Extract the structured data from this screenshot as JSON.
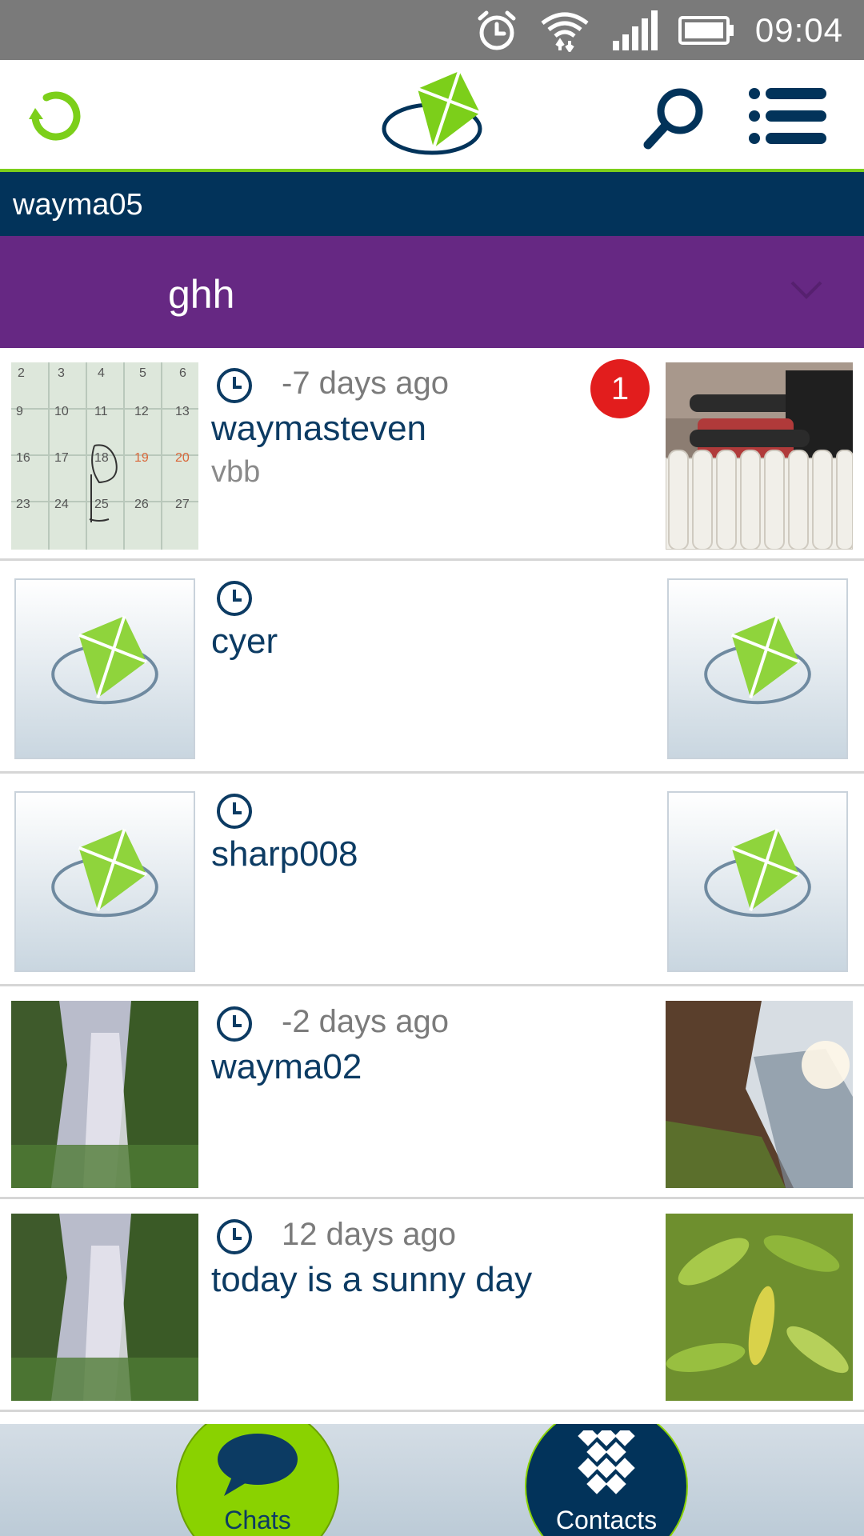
{
  "status_bar": {
    "time": "09:04",
    "icons": [
      "alarm-icon",
      "wifi-icon",
      "signal-icon",
      "battery-icon"
    ]
  },
  "app_bar": {
    "icons": [
      "refresh-icon",
      "app-logo-icon",
      "search-icon",
      "menu-icon"
    ]
  },
  "user": {
    "name": "wayma05"
  },
  "group": {
    "name": "ghh"
  },
  "chats": [
    {
      "time_ago": "-7 days ago",
      "title": "waymasteven",
      "preview": "vbb",
      "badge": "1"
    },
    {
      "time_ago": "",
      "title": "cyer",
      "preview": "",
      "badge": ""
    },
    {
      "time_ago": "",
      "title": "sharp008",
      "preview": "",
      "badge": ""
    },
    {
      "time_ago": "-2 days ago",
      "title": "wayma02",
      "preview": "",
      "badge": ""
    },
    {
      "time_ago": "12 days ago",
      "title": "today is a sunny day",
      "preview": "",
      "badge": ""
    }
  ],
  "nav": {
    "chats_label": "Chats",
    "contacts_label": "Contacts"
  },
  "colors": {
    "accent_green": "#8ad200",
    "navy": "#02335a",
    "purple": "#662883",
    "badge_red": "#e21d1d"
  },
  "calendar_thumb": {
    "rows": [
      [
        "2",
        "3",
        "4",
        "5",
        "6"
      ],
      [
        "9",
        "10",
        "11",
        "12",
        "13"
      ],
      [
        "16",
        "17",
        "18",
        "19",
        "20"
      ],
      [
        "23",
        "24",
        "25",
        "26",
        "27"
      ]
    ]
  }
}
